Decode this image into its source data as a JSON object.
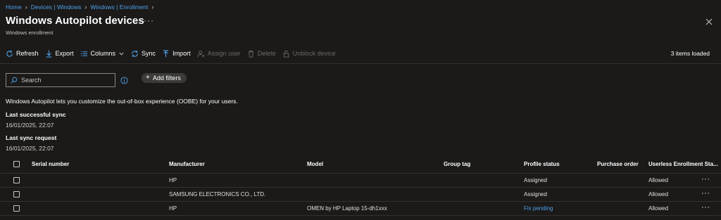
{
  "breadcrumb": [
    "Home",
    "Devices | Windows",
    "Windows | Enrollment"
  ],
  "page": {
    "title": "Windows Autopilot devices",
    "more": "···",
    "subtitle": "Windows enrollment"
  },
  "toolbar": {
    "refresh": "Refresh",
    "export": "Export",
    "columns": "Columns",
    "sync": "Sync",
    "import": "Import",
    "assign_user": "Assign user",
    "delete": "Delete",
    "unblock": "Unblock device",
    "items_loaded": "3 items loaded"
  },
  "search": {
    "placeholder": "Search"
  },
  "filters": {
    "label": "Add filters"
  },
  "description": "Windows Autopilot lets you customize the out-of-box experience (OOBE) for your users.",
  "sync": {
    "last_success_label": "Last successful sync",
    "last_success_value": "16/01/2025, 22:07",
    "last_request_label": "Last sync request",
    "last_request_value": "16/01/2025, 22:07"
  },
  "table": {
    "headers": {
      "serial": "Serial number",
      "manufacturer": "Manufacturer",
      "model": "Model",
      "group_tag": "Group tag",
      "profile_status": "Profile status",
      "purchase_order": "Purchase order",
      "userless": "Userless Enrollment Sta..."
    },
    "rows": [
      {
        "serial": "",
        "manufacturer": "HP",
        "model": "",
        "group_tag": "",
        "profile_status": "Assigned",
        "purchase_order": "",
        "userless": "Allowed",
        "more": "···"
      },
      {
        "serial": "",
        "manufacturer": "SAMSUNG ELECTRONICS CO., LTD.",
        "model": "",
        "group_tag": "",
        "profile_status": "Assigned",
        "purchase_order": "",
        "userless": "Allowed",
        "more": "···"
      },
      {
        "serial": "",
        "manufacturer": "HP",
        "model": "OMEN by HP Laptop 15-dh1xxx",
        "group_tag": "",
        "profile_status": "Fix pending",
        "purchase_order": "",
        "userless": "Allowed",
        "more": "···"
      }
    ]
  },
  "colors": {
    "background": "#1b1a19",
    "link": "#4fa0ea",
    "divider": "#323130"
  }
}
